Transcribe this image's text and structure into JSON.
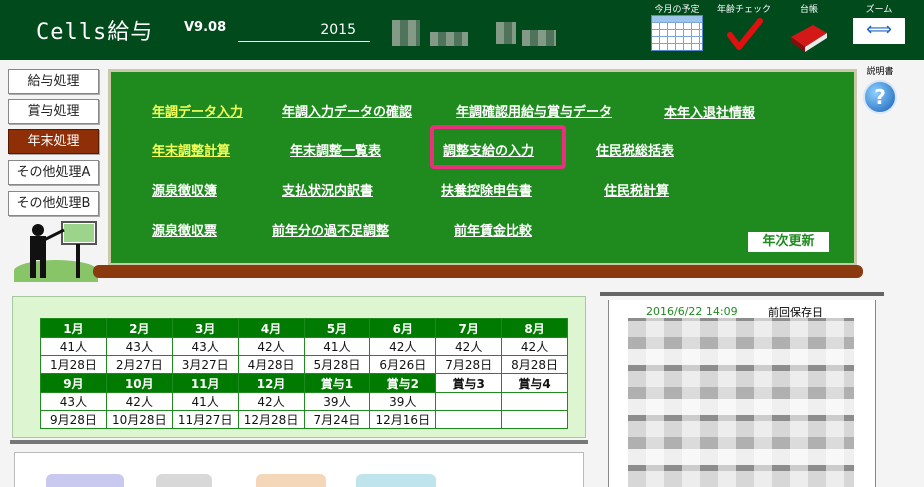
{
  "header": {
    "app_title": "Cells給与",
    "version": "V9.08",
    "year": "2015",
    "icons": {
      "calendar_label": "今月の予定",
      "age_check_label": "年齢チェック",
      "ledger_label": "台帳",
      "zoom_label": "ズーム"
    }
  },
  "sidebar": {
    "items": [
      {
        "label": "給与処理"
      },
      {
        "label": "賞与処理"
      },
      {
        "label": "年末処理"
      },
      {
        "label": "その他処理A"
      },
      {
        "label": "その他処理B"
      }
    ]
  },
  "help": {
    "label": "説明書",
    "glyph": "?"
  },
  "board": {
    "row1": [
      "年調データ入力",
      "年調入力データの確認",
      "年調確認用給与賞与データ",
      "本年入退社情報"
    ],
    "row2": [
      "年末調整計算",
      "年末調整一覧表",
      "調整支給の入力",
      "住民税総括表"
    ],
    "row3": [
      "源泉徴収簿",
      "支払状況内訳書",
      "扶養控除申告書",
      "住民税計算"
    ],
    "row4": [
      "源泉徴収票",
      "前年分の過不足調整",
      "前年賃金比較"
    ],
    "year_update": "年次更新"
  },
  "months_table": {
    "row1_headers": [
      "1月",
      "2月",
      "3月",
      "4月",
      "5月",
      "6月",
      "7月",
      "8月"
    ],
    "row1_counts": [
      "41人",
      "43人",
      "43人",
      "42人",
      "41人",
      "42人",
      "42人",
      "42人"
    ],
    "row1_dates": [
      "1月28日",
      "2月27日",
      "3月27日",
      "4月28日",
      "5月28日",
      "6月26日",
      "7月28日",
      "8月28日"
    ],
    "row2_headers": [
      "9月",
      "10月",
      "11月",
      "12月",
      "賞与1",
      "賞与2",
      "賞与3",
      "賞与4"
    ],
    "row2_counts": [
      "43人",
      "42人",
      "41人",
      "42人",
      "39人",
      "39人",
      "",
      ""
    ],
    "row2_dates": [
      "9月28日",
      "10月28日",
      "11月27日",
      "12月28日",
      "7月24日",
      "12月16日",
      "",
      ""
    ]
  },
  "save_info": {
    "datetime": "2016/6/22 14:09",
    "label": "前回保存日"
  }
}
